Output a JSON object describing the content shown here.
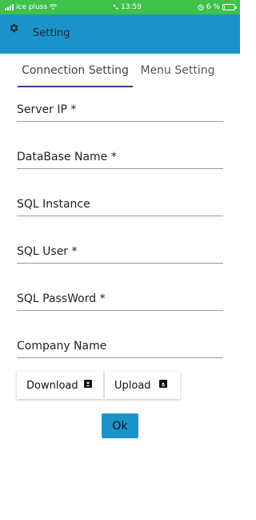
{
  "status_bar": {
    "carrier": "ice pluss",
    "time": "13:59",
    "battery": "6 %",
    "battery_level": 0.06
  },
  "app_bar": {
    "title": "Setting",
    "icon": "gear-icon"
  },
  "tabs": [
    {
      "label": "Connection Setting",
      "active": true
    },
    {
      "label": "Menu Setting",
      "active": false
    }
  ],
  "fields": {
    "server_ip": "Server IP *",
    "database_name": "DataBase Name *",
    "sql_instance": "SQL Instance",
    "sql_user": "SQL User *",
    "sql_password": "SQL PassWord *",
    "company_name": "Company Name"
  },
  "buttons": {
    "download": "Download",
    "upload": "Upload",
    "ok": "Ok"
  },
  "colors": {
    "status_bar": "#3fc14c",
    "primary": "#1c93c8",
    "tab_indicator": "#3d3d9e"
  }
}
